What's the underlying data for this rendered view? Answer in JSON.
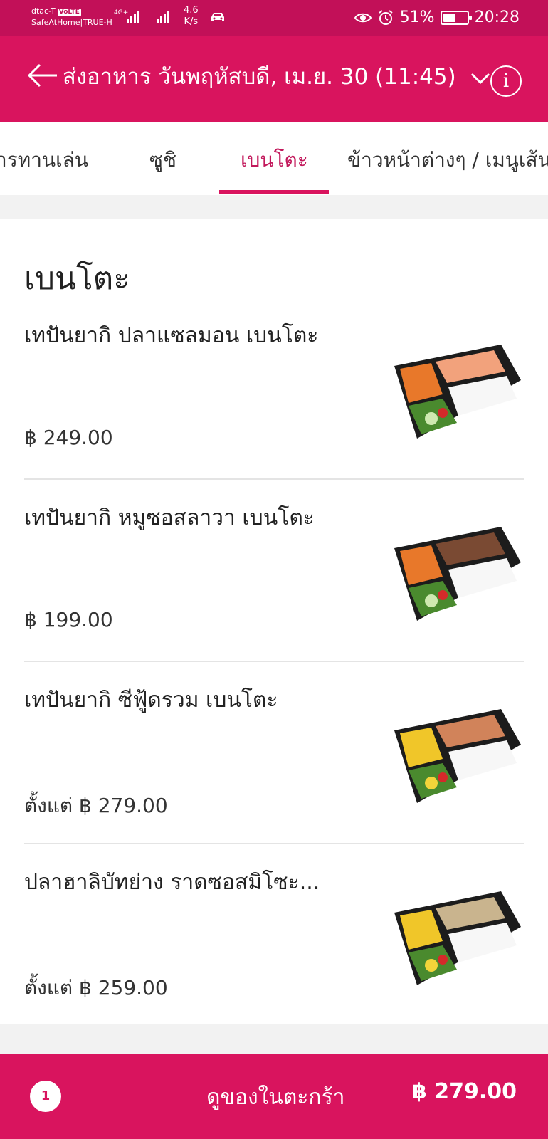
{
  "status_bar": {
    "carrier": "dtac-T",
    "volte": "VoLTE",
    "network_label": "SafeAtHome|TRUE-H",
    "network_type": "4G+",
    "speed_value": "4.6",
    "speed_unit": "K/s",
    "battery_percent": "51%",
    "battery_level": 0.51,
    "time": "20:28"
  },
  "header": {
    "title": "ส่งอาหาร วันพฤหัสบดี, เม.ย. 30 (11:45)",
    "info_glyph": "i"
  },
  "tabs": [
    {
      "label": "ารทานเล่น"
    },
    {
      "label": "ซูชิ"
    },
    {
      "label": "เบนโตะ"
    },
    {
      "label": "ข้าวหน้าต่างๆ / เมนูเส้น"
    }
  ],
  "active_tab": 2,
  "section": {
    "title": "เบนโตะ"
  },
  "items": [
    {
      "name": "เทปันยากิ ปลาแซลมอน เบนโตะ",
      "price": "฿ 249.00"
    },
    {
      "name": "เทปันยากิ หมูซอสลาวา เบนโตะ",
      "price": "฿ 199.00"
    },
    {
      "name": "เทปันยากิ ซีฟู้ดรวม เบนโตะ",
      "price": "ตั้งแต่ ฿ 279.00"
    },
    {
      "name": "ปลาฮาลิบัทย่าง ราดซอสมิโซะ...",
      "price": "ตั้งแต่ ฿ 259.00"
    }
  ],
  "cart": {
    "count": "1",
    "label": "ดูของในตะกร้า",
    "total": "฿ 279.00"
  },
  "colors": {
    "status_bar": "#c21058",
    "brand": "#d9145e"
  },
  "icons": {
    "back": "arrow-left-icon",
    "expand": "chevron-down-icon",
    "info": "info-icon"
  }
}
